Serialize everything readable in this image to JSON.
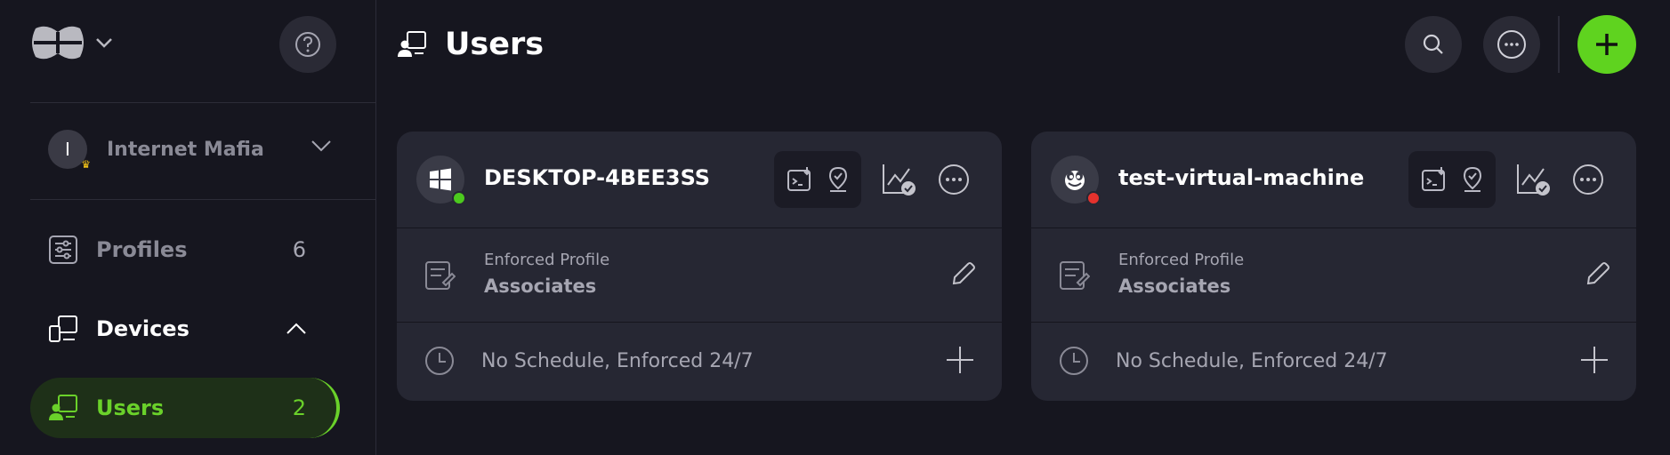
{
  "sidebar": {
    "org_initial": "I",
    "org_name": "Internet Mafia",
    "items": [
      {
        "label": "Profiles",
        "count": "6"
      },
      {
        "label": "Devices",
        "count": ""
      },
      {
        "label": "Users",
        "count": "2"
      }
    ]
  },
  "header": {
    "title": "Users"
  },
  "colors": {
    "accent": "#5fd31f",
    "online": "#4cc91e",
    "offline": "#e5322d",
    "background": "#16161f",
    "card": "#262733"
  },
  "devices": [
    {
      "name": "DESKTOP-4BEE3SS",
      "os_icon": "windows-icon",
      "status": "online",
      "profile_label": "Enforced Profile",
      "profile_name": "Associates",
      "schedule": "No Schedule, Enforced 24/7"
    },
    {
      "name": "test-virtual-machine",
      "os_icon": "linux-icon",
      "status": "offline",
      "profile_label": "Enforced Profile",
      "profile_name": "Associates",
      "schedule": "No Schedule, Enforced 24/7"
    }
  ]
}
